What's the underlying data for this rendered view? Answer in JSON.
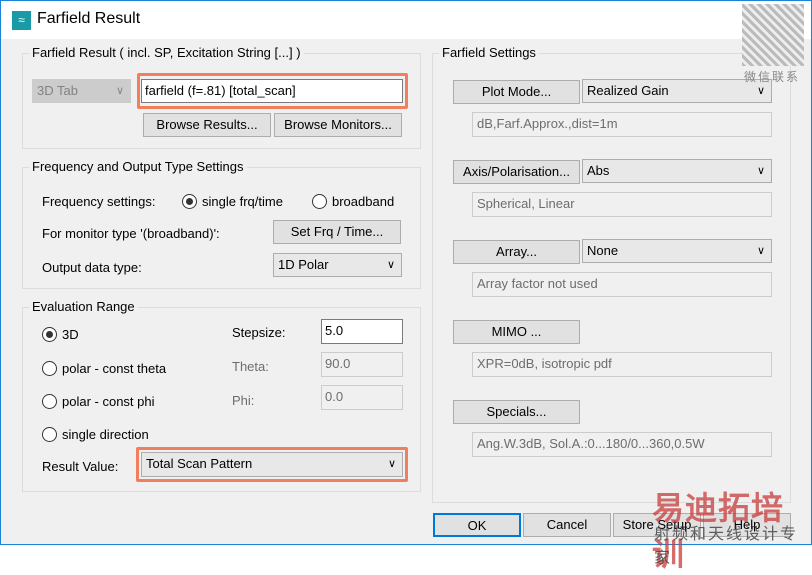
{
  "window": {
    "title": "Farfield Result"
  },
  "result_group": {
    "label": "Farfield Result ( incl. SP, Excitation String [...] )",
    "tab_combo": "3D Tab",
    "result_value": "farfield (f=.81) [total_scan]",
    "browse_results": "Browse Results...",
    "browse_monitors": "Browse Monitors..."
  },
  "freq_group": {
    "label": "Frequency and Output Type Settings",
    "freq_label": "Frequency settings:",
    "single": "single frq/time",
    "broadband": "broadband",
    "monitor_label": "For monitor type '(broadband)':",
    "set_frq": "Set Frq / Time...",
    "output_label": "Output data type:",
    "output_value": "1D Polar"
  },
  "eval_group": {
    "label": "Evaluation Range",
    "r3d": "3D",
    "polar_theta": "polar - const theta",
    "polar_phi": "polar - const phi",
    "single_dir": "single direction",
    "stepsize_label": "Stepsize:",
    "stepsize": "5.0",
    "theta_label": "Theta:",
    "theta": "90.0",
    "phi_label": "Phi:",
    "phi": "0.0",
    "result_label": "Result Value:",
    "result_value": "Total Scan Pattern"
  },
  "settings": {
    "label": "Farfield Settings",
    "plot_mode": "Plot Mode...",
    "plot_value": "Realized Gain",
    "plot_info": "dB,Farf.Approx.,dist=1m",
    "axis": "Axis/Polarisation...",
    "axis_value": "Abs",
    "axis_info": "Spherical, Linear",
    "array": "Array...",
    "array_value": "None",
    "array_info": "Array factor not used",
    "mimo": "MIMO ...",
    "mimo_info": "XPR=0dB, isotropic pdf",
    "specials": "Specials...",
    "specials_info": "Ang.W.3dB, Sol.A.:0...180/0...360,0.5W"
  },
  "footer": {
    "ok": "OK",
    "cancel": "Cancel",
    "store": "Store Setup",
    "help": "Help"
  },
  "watermark": {
    "top": "微信联系",
    "main": "易迪拓培训",
    "sub": "射频和天线设计专家"
  },
  "colors": {
    "highlight": "#ef7f5f",
    "accent": "#1883d7"
  }
}
